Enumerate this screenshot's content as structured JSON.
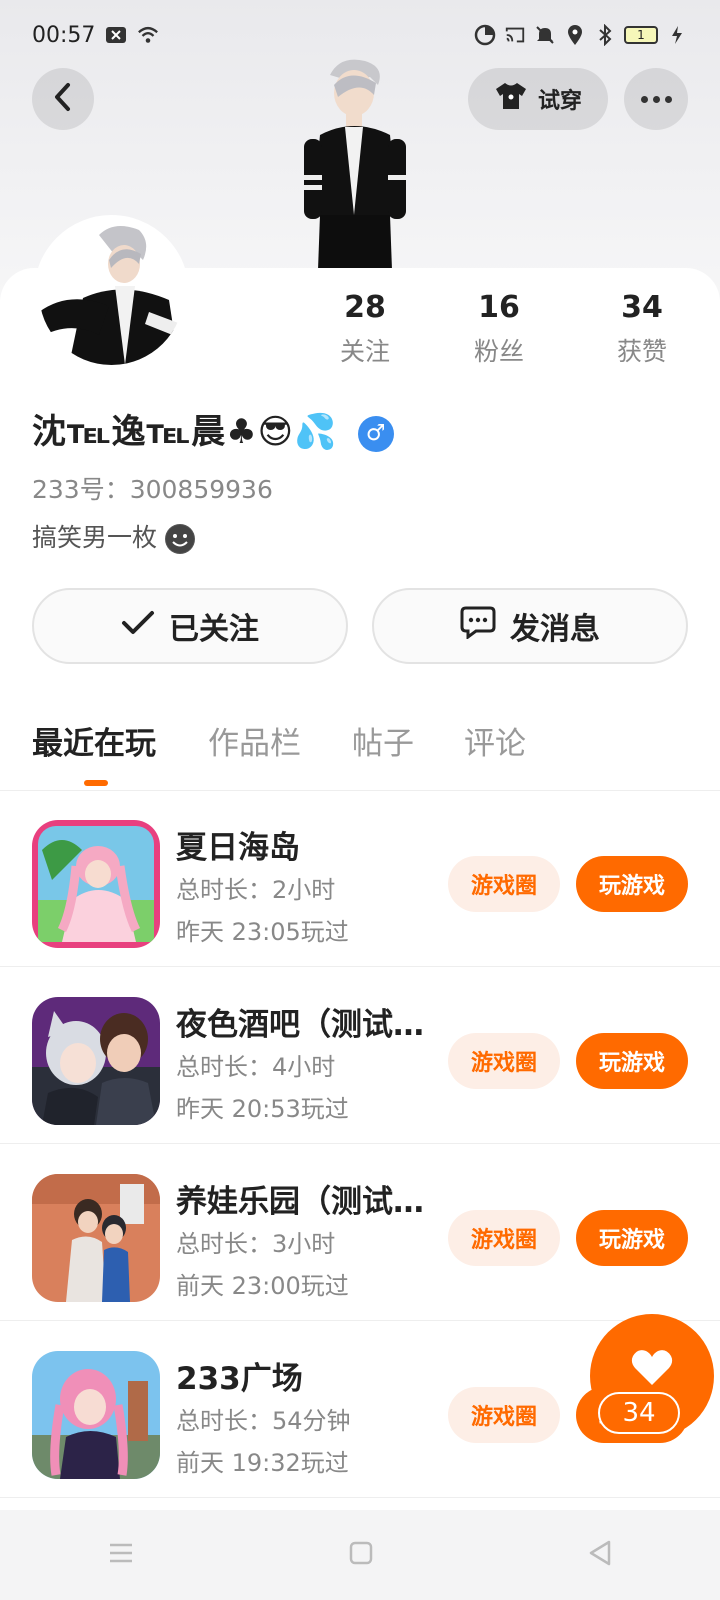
{
  "status": {
    "time": "00:57",
    "battery": "1"
  },
  "header": {
    "tryon_label": "试穿"
  },
  "profile": {
    "stats": [
      {
        "value": "28",
        "label": "关注"
      },
      {
        "value": "16",
        "label": "粉丝"
      },
      {
        "value": "34",
        "label": "获赞"
      }
    ],
    "name": "沈℡逸℡晨♣😎💦",
    "gender_symbol": "♂",
    "uid": "233号：300859936",
    "bio": "搞笑男一枚"
  },
  "actions": {
    "followed_label": "已关注",
    "message_label": "发消息"
  },
  "tabs": [
    "最近在玩",
    "作品栏",
    "帖子",
    "评论"
  ],
  "games": [
    {
      "title": "夏日海岛",
      "duration": "总时长：2小时",
      "last_played": "昨天 23:05玩过",
      "circle_label": "游戏圈",
      "play_label": "玩游戏"
    },
    {
      "title": "夜色酒吧（测试...",
      "duration": "总时长：4小时",
      "last_played": "昨天 20:53玩过",
      "circle_label": "游戏圈",
      "play_label": "玩游戏"
    },
    {
      "title": "养娃乐园（测试...",
      "duration": "总时长：3小时",
      "last_played": "前天 23:00玩过",
      "circle_label": "游戏圈",
      "play_label": "玩游戏"
    },
    {
      "title": "233广场",
      "duration": "总时长：54分钟",
      "last_played": "前天 19:32玩过",
      "circle_label": "游戏圈",
      "play_label": "玩游戏"
    }
  ],
  "like_float": {
    "count": "34"
  },
  "colors": {
    "accent": "#ff6a00",
    "accent_soft": "#fdeee6",
    "gender": "#3a8ef0"
  }
}
